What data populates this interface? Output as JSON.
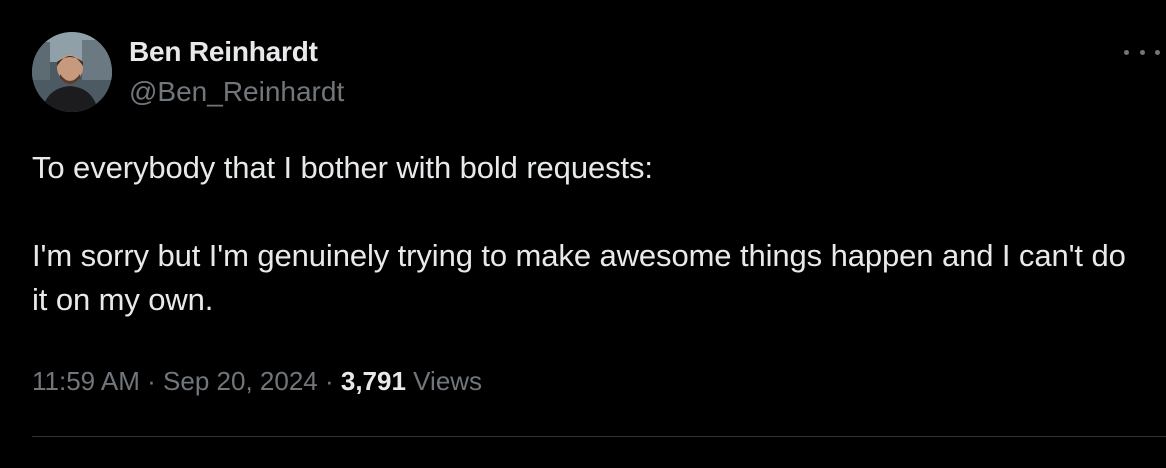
{
  "author": {
    "display_name": "Ben Reinhardt",
    "handle": "@Ben_Reinhardt"
  },
  "tweet": {
    "paragraphs": [
      "To everybody that I bother with bold requests:",
      "I'm sorry but I'm genuinely trying to make awesome things happen and I can't do it on my own."
    ],
    "time": "11:59 AM",
    "date": "Sep 20, 2024",
    "views_count": "3,791",
    "views_label": "Views",
    "separator": " · "
  },
  "icons": {
    "more": "more-horizontal-icon",
    "avatar": "avatar"
  },
  "colors": {
    "background": "#000000",
    "primary_text": "#e7e9ea",
    "secondary_text": "#71767b",
    "divider": "#2f3336"
  }
}
